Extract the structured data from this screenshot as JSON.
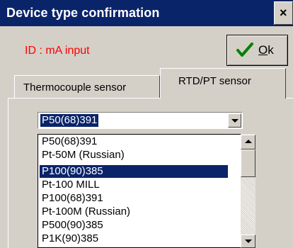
{
  "window": {
    "title": "Device type confirmation",
    "close_glyph": "×",
    "close_icon": "close-icon"
  },
  "device_id_text": "ID : mA input",
  "ok_button": {
    "label_first": "O",
    "label_rest": "k",
    "icon": "check-icon"
  },
  "tabs": [
    {
      "label": "Thermocouple sensor",
      "active": false
    },
    {
      "label": "RTD/PT sensor",
      "active": true
    }
  ],
  "sensor_select": {
    "value": "P50(68)391",
    "options": [
      "P50(68)391",
      "Pt-50M (Russian)",
      "P100(90)385",
      "Pt-100 MILL",
      "P100(68)391",
      "Pt-100M (Russian)",
      "P500(90)385",
      "P1K(90)385"
    ],
    "highlighted_index": 2
  },
  "colors": {
    "title_bar": "#0a246a",
    "selection": "#0a246a",
    "id_text": "#ff0000",
    "face": "#d4d0c8"
  }
}
